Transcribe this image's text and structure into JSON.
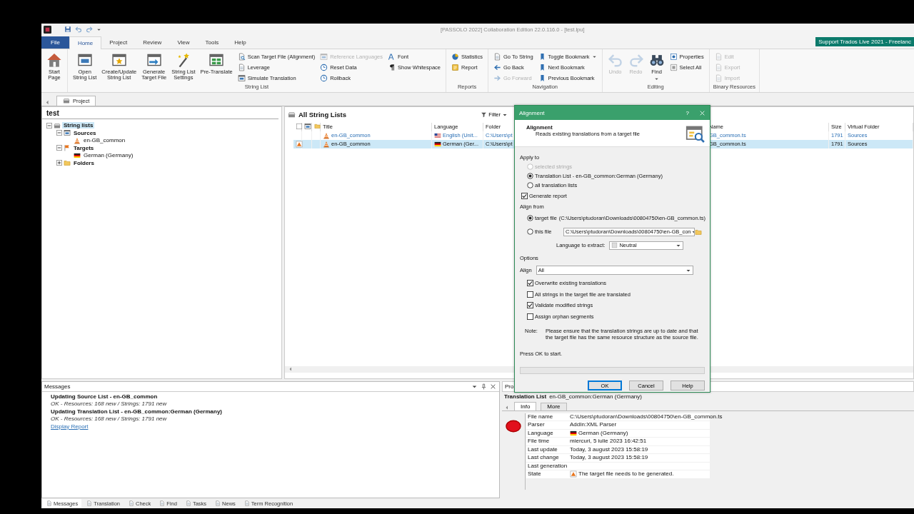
{
  "window": {
    "title": "[PASSOLO 2022] Collaboration Edition 22.0.116.0 - [test.lpu]"
  },
  "menu_tabs": [
    {
      "label": "File",
      "kind": "file",
      "selected": false
    },
    {
      "label": "Home",
      "kind": "tab",
      "selected": true
    },
    {
      "label": "Project",
      "kind": "tab",
      "selected": false
    },
    {
      "label": "Review",
      "kind": "tab",
      "selected": false
    },
    {
      "label": "View",
      "kind": "tab",
      "selected": false
    },
    {
      "label": "Tools",
      "kind": "tab",
      "selected": false
    },
    {
      "label": "Help",
      "kind": "tab",
      "selected": false
    }
  ],
  "banner": "Support Trados Live 2021 - Freelanc",
  "ribbon": {
    "groups": [
      {
        "large": [
          {
            "label": "Start\nPage",
            "disabled": false,
            "dropdown": false
          }
        ]
      },
      {
        "label": "String List",
        "large": [
          {
            "label": "Open\nString List",
            "disabled": false,
            "dropdown": false
          },
          {
            "label": "Create/Update\nString List",
            "disabled": false,
            "dropdown": false
          },
          {
            "label": "Generate\nTarget File",
            "disabled": false,
            "dropdown": false
          },
          {
            "label": "String List\nSettings",
            "disabled": false,
            "dropdown": false
          },
          {
            "label": "Pre-Translate",
            "disabled": false,
            "dropdown": false
          }
        ],
        "columns": [
          [
            {
              "label": "Scan Target File (Alignment)",
              "disabled": false,
              "dropdown": false
            },
            {
              "label": "Leverage",
              "disabled": false,
              "dropdown": false
            },
            {
              "label": "Simulate Translation",
              "disabled": false,
              "dropdown": false
            }
          ],
          [
            {
              "label": "Reference Languages",
              "disabled": true,
              "dropdown": false
            },
            {
              "label": "Reset Data",
              "disabled": false,
              "dropdown": false
            },
            {
              "label": "Rollback",
              "disabled": false,
              "dropdown": false
            }
          ],
          [
            {
              "label": "Font",
              "disabled": false,
              "dropdown": false
            },
            {
              "label": "Show Whitespace",
              "disabled": false,
              "dropdown": false
            }
          ]
        ]
      },
      {
        "label": "Reports",
        "columns": [
          [
            {
              "label": "Statistics",
              "disabled": false,
              "dropdown": false
            },
            {
              "label": "Report",
              "disabled": false,
              "dropdown": false
            }
          ]
        ]
      },
      {
        "label": "Navigation",
        "columns": [
          [
            {
              "label": "Go To String",
              "disabled": false,
              "dropdown": false
            },
            {
              "label": "Go Back",
              "disabled": false,
              "dropdown": false
            },
            {
              "label": "Go Forward",
              "disabled": true,
              "dropdown": false
            }
          ],
          [
            {
              "label": "Toggle Bookmark",
              "disabled": false,
              "dropdown": true
            },
            {
              "label": "Next Bookmark",
              "disabled": false,
              "dropdown": false
            },
            {
              "label": "Previous Bookmark",
              "disabled": false,
              "dropdown": false
            }
          ]
        ]
      },
      {
        "label": "Editing",
        "large": [
          {
            "label": "Undo",
            "disabled": true,
            "dropdown": false
          },
          {
            "label": "Redo",
            "disabled": true,
            "dropdown": false
          },
          {
            "label": "Find",
            "disabled": false,
            "dropdown": true
          }
        ],
        "columns": [
          [
            {
              "label": "Properties",
              "disabled": false,
              "dropdown": false
            },
            {
              "label": "Select All",
              "disabled": false,
              "dropdown": false
            }
          ]
        ]
      },
      {
        "label": "Binary Resources",
        "columns": [
          [
            {
              "label": "Edit",
              "disabled": true,
              "dropdown": false
            },
            {
              "label": "Export",
              "disabled": true,
              "dropdown": false
            },
            {
              "label": "Import",
              "disabled": true,
              "dropdown": false
            }
          ]
        ]
      }
    ]
  },
  "document_tabs": [
    {
      "label": "Project",
      "selected": true
    }
  ],
  "project_tree": {
    "title": "test",
    "nodes": [
      {
        "label": "String lists",
        "kind": "group",
        "expanded": true,
        "selected": true,
        "children": [
          {
            "label": "Sources",
            "kind": "sources",
            "expanded": true,
            "selected": false,
            "children": [
              {
                "label": "en-GB_common",
                "kind": "string_list",
                "selected": false
              }
            ]
          },
          {
            "label": "Targets",
            "kind": "targets",
            "expanded": true,
            "selected": false,
            "children": [
              {
                "label": "German (Germany)",
                "kind": "language",
                "selected": false
              }
            ]
          },
          {
            "label": "Folders",
            "kind": "folders",
            "expanded": false,
            "selected": false
          }
        ]
      }
    ]
  },
  "string_lists": {
    "title": "All String Lists",
    "filter": "Filter",
    "columns": [
      "Title",
      "Language",
      "Folder",
      "Name",
      "Size",
      "Virtual Folder"
    ],
    "rows": [
      {
        "kind": "source",
        "selected": false,
        "warning": false,
        "title": "en-GB_common",
        "language": "English (Unit...",
        "folder": "C:\\Users\\pt",
        "name": "GB_common.ts",
        "size": "1791",
        "virtual_folder": "Sources"
      },
      {
        "kind": "target",
        "selected": true,
        "warning": true,
        "title": "en-GB_common",
        "language": "German (Ger...",
        "folder": "C:\\Users\\pt",
        "name": "GB_common.ts",
        "size": "1791",
        "virtual_folder": "Sources"
      }
    ]
  },
  "alignment_dialog": {
    "title": "Alignment",
    "help": "?",
    "heading": "Alignment",
    "description": "Reads existing translations from a target file",
    "apply_to": {
      "label": "Apply to",
      "options": [
        {
          "label": "selected strings",
          "selected": false,
          "disabled": true
        },
        {
          "label": "Translation List - en-GB_common:German (Germany)",
          "selected": true,
          "disabled": false
        },
        {
          "label": "all translation lists",
          "selected": false,
          "disabled": false
        }
      ]
    },
    "generate_report": {
      "label": "Generate report",
      "checked": true
    },
    "align_from": {
      "label": "Align from",
      "options": [
        {
          "label": "target file",
          "kind": "path",
          "selected": true,
          "value": "(C:\\Users\\ptudoran\\Downloads\\00804750\\en-GB_common.ts)"
        },
        {
          "label": "this file",
          "kind": "field",
          "selected": false,
          "value": "C:\\Users\\ptudoran\\Downloads\\00804750\\en-GB_con"
        }
      ]
    },
    "language_to_extract": {
      "label": "Language to extract:",
      "value": "Neutral"
    },
    "options_label": "Options",
    "align": {
      "label": "Align",
      "value": "All"
    },
    "checkboxes": [
      {
        "label": "Overwrite existing translations",
        "checked": true
      },
      {
        "label": "All strings in the target file are translated",
        "checked": false
      },
      {
        "label": "Validate modified strings",
        "checked": true
      },
      {
        "label": "Assign orphan segments",
        "checked": false
      }
    ],
    "note_label": "Note:",
    "note": "Please ensure that the translation strings are up to date and that the target file has the same resource structure as the source file.",
    "prompt": "Press OK to start.",
    "progress": {
      "level": 0
    },
    "buttons": [
      {
        "label": "OK",
        "default": true
      },
      {
        "label": "Cancel",
        "default": false
      },
      {
        "label": "Help",
        "default": false
      }
    ]
  },
  "messages": {
    "title": "Messages",
    "lines": [
      {
        "kind": "heading",
        "text": "Updating Source List - en-GB_common"
      },
      {
        "kind": "detail",
        "text": "OK - Resources:  168 new / Strings:  1791 new"
      },
      {
        "kind": "heading",
        "text": "Updating Translation List - en-GB_common:German (Germany)"
      },
      {
        "kind": "detail",
        "text": "OK - Resources:  168 new / Strings:  1791 new"
      },
      {
        "kind": "link",
        "text": "Display Report"
      }
    ]
  },
  "properties": {
    "title": "Pro",
    "heading": "Translation List",
    "subject": "en-GB_common:German (Germany)",
    "tabs": [
      {
        "label": "Info",
        "selected": true
      },
      {
        "label": "More",
        "selected": false
      }
    ],
    "rows": [
      {
        "label": "File name",
        "kind": "text",
        "value": "C:\\Users\\ptudoran\\Downloads\\00804750\\en-GB_common.ts"
      },
      {
        "label": "Parser",
        "kind": "text",
        "value": "AddIn:XML Parser"
      },
      {
        "label": "Language",
        "kind": "language",
        "value": "German (Germany)"
      },
      {
        "label": "File time",
        "kind": "text",
        "value": "miercuri, 5 iulie 2023 16:42:51"
      },
      {
        "label": "Last update",
        "kind": "text",
        "value": "Today, 3 august 2023 15:58:19"
      },
      {
        "label": "Last change",
        "kind": "text",
        "value": "Today, 3 august 2023 15:58:19"
      },
      {
        "label": "Last generation",
        "kind": "text"
      },
      {
        "label": "State",
        "kind": "warning",
        "value": "The target file needs to be generated."
      }
    ]
  },
  "bottom_tabs": [
    {
      "label": "Messages",
      "selected": true
    },
    {
      "label": "Translation",
      "selected": false
    },
    {
      "label": "Check",
      "selected": false
    },
    {
      "label": "Find",
      "selected": false
    },
    {
      "label": "Tasks",
      "selected": false
    },
    {
      "label": "News",
      "selected": false
    },
    {
      "label": "Term Recognition",
      "selected": false
    }
  ]
}
